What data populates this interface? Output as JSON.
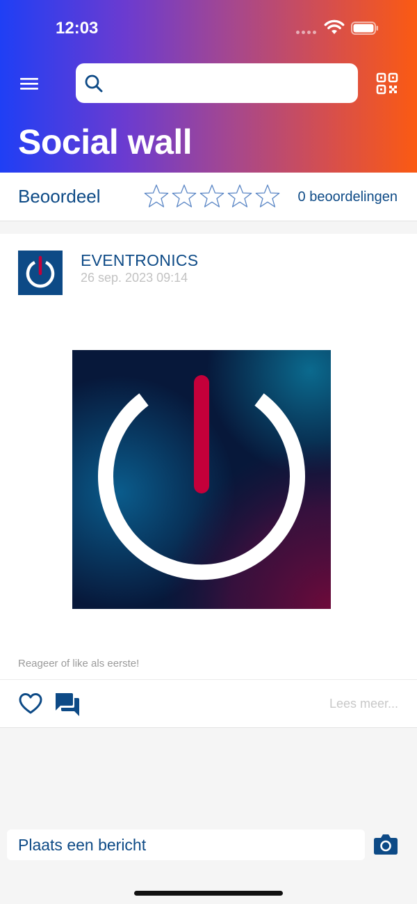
{
  "status_bar": {
    "time": "12:03"
  },
  "header": {
    "title": "Social wall",
    "search": {
      "value": "",
      "placeholder": ""
    }
  },
  "rating": {
    "label": "Beoordeel",
    "stars_filled": 0,
    "stars_total": 5,
    "count_text": "0 beoordelingen"
  },
  "post": {
    "author": "EVENTRONICS",
    "date": "26 sep. 2023 09:14",
    "engagement_text": "Reageer of like als eerste!",
    "read_more": "Lees meer..."
  },
  "composer": {
    "placeholder": "Plaats een bericht"
  },
  "colors": {
    "brand_blue": "#0d4a86",
    "gradient_start": "#1f3ff5",
    "gradient_end": "#fb5a12",
    "logo_red": "#c4003a"
  },
  "icons": [
    "menu-icon",
    "search-icon",
    "qr-code-icon",
    "star-icon",
    "heart-icon",
    "comments-icon",
    "camera-icon"
  ]
}
